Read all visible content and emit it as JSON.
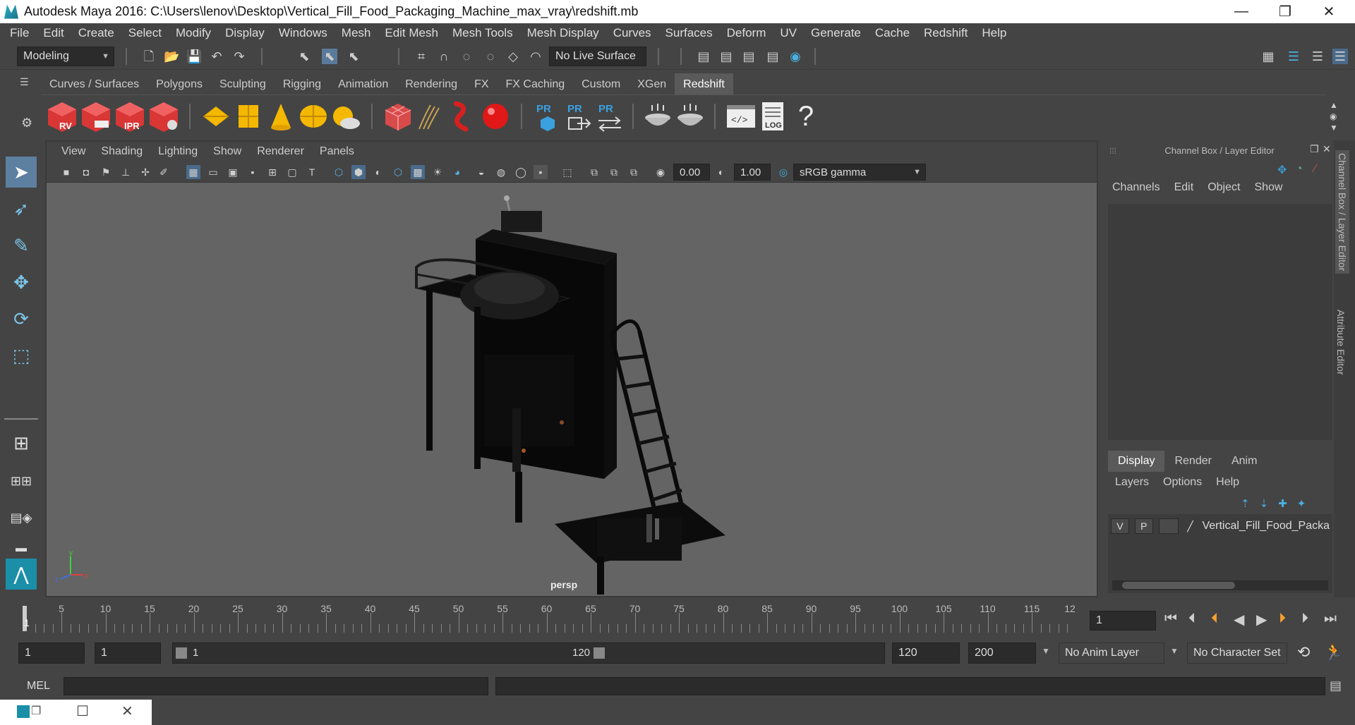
{
  "window": {
    "title": "Autodesk Maya 2016: C:\\Users\\lenov\\Desktop\\Vertical_Fill_Food_Packaging_Machine_max_vray\\redshift.mb",
    "minimize": "—",
    "maximize": "❐",
    "close": "✕"
  },
  "menubar": [
    "File",
    "Edit",
    "Create",
    "Select",
    "Modify",
    "Display",
    "Windows",
    "Mesh",
    "Edit Mesh",
    "Mesh Tools",
    "Mesh Display",
    "Curves",
    "Surfaces",
    "Deform",
    "UV",
    "Generate",
    "Cache",
    "Redshift",
    "Help"
  ],
  "status": {
    "mode": "Modeling",
    "live_surface": "No Live Surface"
  },
  "shelf": {
    "tabs": [
      "Curves / Surfaces",
      "Polygons",
      "Sculpting",
      "Rigging",
      "Animation",
      "Rendering",
      "FX",
      "FX Caching",
      "Custom",
      "XGen",
      "Redshift"
    ],
    "active_tab": "Redshift",
    "labels": {
      "rv": "RV",
      "ipr": "IPR",
      "pr1": "PR",
      "pr2": "PR",
      "pr3": "PR",
      "log": "LOG",
      "help": "?"
    }
  },
  "viewport": {
    "menu": [
      "View",
      "Shading",
      "Lighting",
      "Show",
      "Renderer",
      "Panels"
    ],
    "exposure": "0.00",
    "gamma": "1.00",
    "color_space": "sRGB gamma",
    "camera": "persp",
    "axis_x": "x",
    "axis_y": "y",
    "axis_z": "z"
  },
  "channel_box": {
    "title": "Channel Box / Layer Editor",
    "menu": [
      "Channels",
      "Edit",
      "Object",
      "Show"
    ],
    "layer_tabs": [
      "Display",
      "Render",
      "Anim"
    ],
    "active_layer_tab": "Display",
    "layer_menu": [
      "Layers",
      "Options",
      "Help"
    ],
    "layer": {
      "v": "V",
      "p": "P",
      "name": "Vertical_Fill_Food_Packa"
    }
  },
  "side_tabs": [
    "Channel Box / Layer Editor",
    "Attribute Editor"
  ],
  "timeline": {
    "ticks": [
      "5",
      "10",
      "15",
      "20",
      "25",
      "30",
      "35",
      "40",
      "45",
      "50",
      "55",
      "60",
      "65",
      "70",
      "75",
      "80",
      "85",
      "90",
      "95",
      "100",
      "105",
      "110",
      "115",
      "12"
    ],
    "current_frame_marker": "1",
    "current_frame": "1"
  },
  "range": {
    "start": "1",
    "playback_start": "1",
    "slider_start": "1",
    "slider_end": "120",
    "playback_end": "120",
    "end": "200",
    "anim_layer": "No Anim Layer",
    "character_set": "No Character Set"
  },
  "command": {
    "label": "MEL"
  }
}
